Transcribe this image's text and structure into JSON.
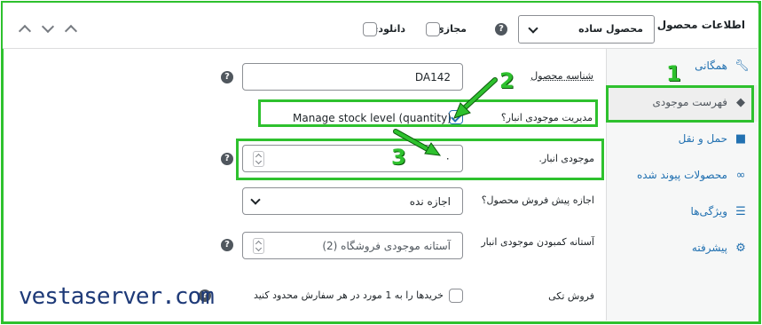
{
  "header": {
    "title": "اطلاعات محصول —",
    "product_type": "محصول ساده",
    "virtual_label": "مجازی:",
    "downloadable_label": "دانلودی:"
  },
  "sidebar": {
    "items": [
      {
        "label": "همگانی",
        "icon": "wrench-icon",
        "active": false
      },
      {
        "label": "فهرست موجودی",
        "icon": "tag-icon",
        "active": true
      },
      {
        "label": "حمل و نقل",
        "icon": "truck-icon",
        "active": false
      },
      {
        "label": "محصولات پیوند شده",
        "icon": "link-icon",
        "active": false
      },
      {
        "label": "ویژگی‌ها",
        "icon": "list-icon",
        "active": false
      },
      {
        "label": "پیشرفته",
        "icon": "gear-icon",
        "active": false
      }
    ]
  },
  "inventory": {
    "sku_label": "شناسه محصول",
    "sku_value": "DA142",
    "manage_stock_label": "مدیریت موجودی انبار؟",
    "manage_stock_checked": true,
    "manage_stock_desc": "Manage stock level (quantity)",
    "stock_qty_label": "موجودی انبار.",
    "stock_qty_value": "۰",
    "backorders_label": "اجازه پیش فروش محصول؟",
    "backorders_value": "اجازه نده",
    "low_stock_label": "آستانه کمبودن موجودی انبار",
    "low_stock_value": "آستانه موجودی فروشگاه (2)",
    "sold_individually_label": "فروش تکی",
    "sold_individually_desc": "خریدها را به 1 مورد در هر سفارش محدود کنید"
  },
  "annotations": {
    "n1": "1",
    "n2": "2",
    "n3": "3",
    "brand": "vestaserver.com",
    "color": "#2ec12e"
  }
}
